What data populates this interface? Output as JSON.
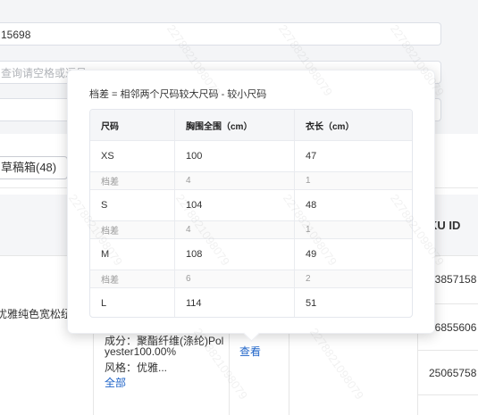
{
  "form": {
    "field1_value": "15698",
    "field2_placeholder": "查询请空格或逗号",
    "field3_value": ""
  },
  "tabs": {
    "drafts": "草稿箱(48)"
  },
  "table": {
    "sku_header": "KU ID",
    "product_title": "优雅纯色宽松纽",
    "attr_material": "成分：聚酯纤维(涤纶)Pol",
    "attr_material2": "yester100.00%",
    "attr_style": "风格：优雅...",
    "attr_all": "全部",
    "view_link": "查看",
    "sku_ids": [
      "03857158",
      "46855606",
      "25065758"
    ]
  },
  "popover": {
    "note": "档差 = 相邻两个尺码较大尺码 - 较小尺码",
    "headers": [
      "尺码",
      "胸围全围（cm）",
      "衣长（cm）"
    ],
    "rows": [
      [
        "XS",
        "100",
        "47"
      ],
      [
        "档差",
        "4",
        "1"
      ],
      [
        "S",
        "104",
        "48"
      ],
      [
        "档差",
        "4",
        "1"
      ],
      [
        "M",
        "108",
        "49"
      ],
      [
        "档差",
        "6",
        "2"
      ],
      [
        "L",
        "114",
        "51"
      ]
    ]
  },
  "watermark": "2278821098079"
}
